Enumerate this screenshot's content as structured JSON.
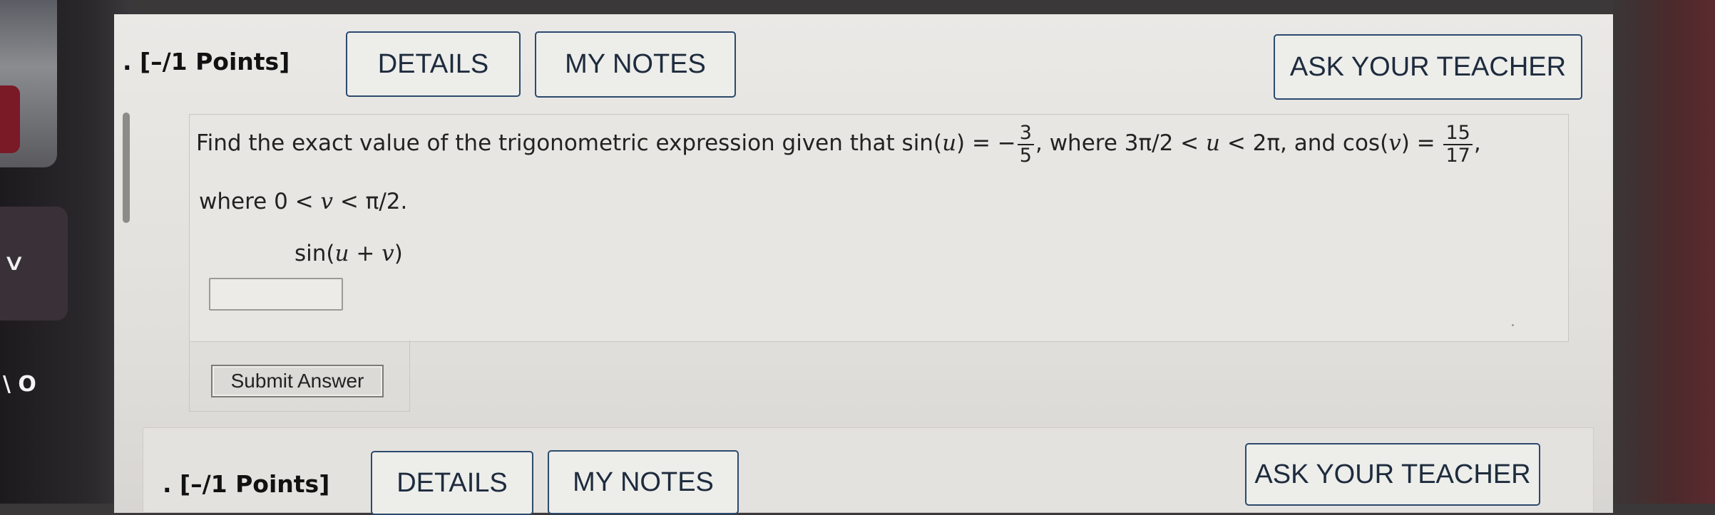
{
  "sidebar": {
    "chevron_glyph": "∨",
    "badge_text": "\\ O"
  },
  "question1": {
    "points_label": ". [–/1 Points]",
    "details_label": "DETAILS",
    "notes_label": "MY NOTES",
    "ask_label": "ASK YOUR TEACHER",
    "text_part1": "Find the exact value of the trigonometric expression given that sin(",
    "var_u": "u",
    "text_part2": ") = −",
    "frac1_num": "3",
    "frac1_den": "5",
    "text_part3": ", where 3π/2 < ",
    "text_part4": " < 2π, and cos(",
    "var_v": "v",
    "text_part5": ") = ",
    "frac2_num": "15",
    "frac2_den": "17",
    "text_part6": ",",
    "line2_part1": "where 0 < ",
    "line2_part2": " < π/2.",
    "expr_part1": "sin(",
    "expr_part2": " + ",
    "expr_part3": ")",
    "answer_value": "",
    "submit_label": "Submit Answer"
  },
  "question2": {
    "points_label": ". [–/1 Points]",
    "details_label": "DETAILS",
    "notes_label": "MY NOTES",
    "ask_label": "ASK YOUR TEACHER"
  }
}
